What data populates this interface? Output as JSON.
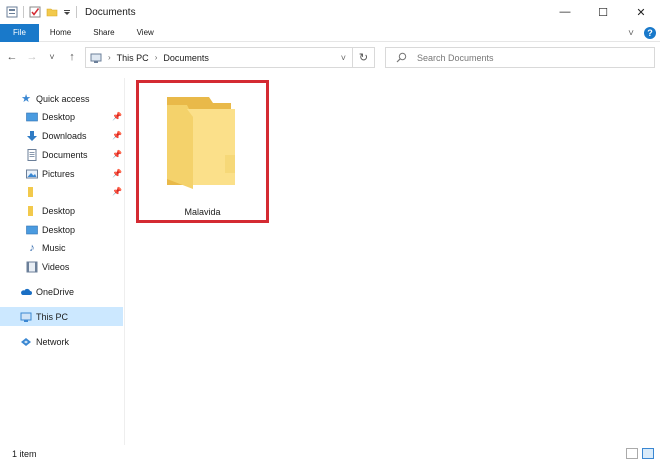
{
  "window": {
    "title": "Documents",
    "minimize_glyph": "—",
    "maximize_glyph": "☐",
    "close_glyph": "✕"
  },
  "ribbon": {
    "tabs": [
      "File",
      "Home",
      "Share",
      "View"
    ],
    "expand_glyph": "˅",
    "help_glyph": "?"
  },
  "nav": {
    "back_glyph": "←",
    "forward_glyph": "→",
    "recent_glyph": "˅",
    "up_glyph": "↑",
    "breadcrumb": [
      "This PC",
      "Documents"
    ],
    "refresh_glyph": "↻",
    "search_placeholder": "Search Documents"
  },
  "sidebar": {
    "quick_access": "Quick access",
    "items": [
      {
        "label": "Desktop",
        "pinned": true
      },
      {
        "label": "Downloads",
        "pinned": true
      },
      {
        "label": "Documents",
        "pinned": true
      },
      {
        "label": "Pictures",
        "pinned": true
      },
      {
        "label": "",
        "pinned": true
      },
      {
        "label": "Desktop",
        "pinned": false
      },
      {
        "label": "Desktop",
        "pinned": false
      },
      {
        "label": "Music",
        "pinned": false
      },
      {
        "label": "Videos",
        "pinned": false
      }
    ],
    "onedrive": "OneDrive",
    "this_pc": "This PC",
    "network": "Network"
  },
  "content": {
    "folders": [
      {
        "name": "Malavida"
      }
    ]
  },
  "status": {
    "item_count": "1 item"
  },
  "colors": {
    "accent": "#1979ca",
    "selection": "#cce8ff",
    "highlight_frame": "#d42a32",
    "folder": "#f2c94c"
  }
}
